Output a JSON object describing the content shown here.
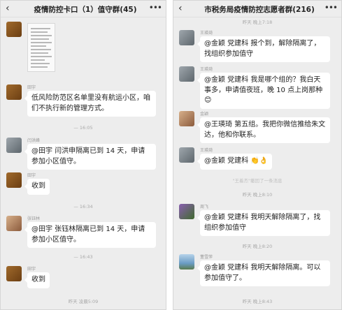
{
  "left": {
    "back_icon": "chevron-left",
    "title": "疫情防控卡口（1）值守群(45)",
    "more_icon": "ellipsis",
    "messages": [
      {
        "type": "image",
        "avatar_color": "#8a5a24"
      },
      {
        "sender": "田宇",
        "text": "低风险防范区名单里没有航运小区，咱们不执行新的管理方式。"
      },
      {
        "time": "— 16:05"
      },
      {
        "sender": "闫洪峰",
        "text": "@田宇  闫洪申隔离已到 14 天，申请参加小区值守。"
      },
      {
        "sender": "田宇",
        "text": "收到"
      },
      {
        "time": "— 16:34"
      },
      {
        "sender": "张钰林",
        "text": "@田宇  张钰林隔离已到 14 天，申请参加小区值守。"
      },
      {
        "time": "— 16:43"
      },
      {
        "sender": "田宇",
        "text": "收到"
      },
      {
        "time": "昨天 凌晨5:09"
      }
    ]
  },
  "right": {
    "back_icon": "chevron-left",
    "title": "市税务局疫情防控志愿者群(216)",
    "more_icon": "ellipsis",
    "messages": [
      {
        "time": "昨天 晚上7:18"
      },
      {
        "sender": "王瑛琦",
        "text": "@金颖  党建科  报个到，解除隔离了，找组织参加值守"
      },
      {
        "sender": "王瑛琦",
        "text": "@金颖  党建科  我是哪个组的？我白天事多，申请值夜班，晚 10 点上岗那种😊"
      },
      {
        "sender": "金颖",
        "text": "@王瑛琦  第五组。我把你微信推给朱文达，他和你联系。"
      },
      {
        "sender": "王瑛琦",
        "text": "@金颖  党建科  👏👌"
      },
      {
        "system": "\"王着杰\"撤回了一条消息"
      },
      {
        "time": "昨天 晚上8:10"
      },
      {
        "sender": "周飞",
        "text": "@金颖  党建科   我明天解除隔离了，找组织参加值守"
      },
      {
        "time": "昨天 晚上8:20"
      },
      {
        "sender": "董雪萍",
        "text": "@金颖  党建科   我明天解除隔离。可以参加值守了。"
      },
      {
        "time": "昨天 晚上8:43"
      }
    ]
  }
}
